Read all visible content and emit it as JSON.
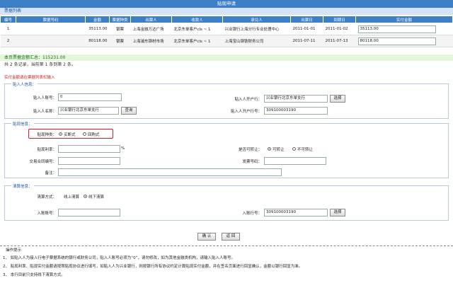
{
  "window": {
    "title": "贴现申请"
  },
  "ticket_list": {
    "section_title": "票据列表",
    "columns": [
      "编号",
      "票据号码",
      "金额",
      "票据种类",
      "出票人",
      "收款人",
      "承兑人",
      "出票日",
      "到期日",
      "实付金额"
    ],
    "rows": [
      {
        "no": "1",
        "amount": "35113.00",
        "kind": "银票",
        "drawer": "上海金融万达广场",
        "payee": "北京东单客户cls ~ 1",
        "acceptor": "兴业银行上海分行专业处理中心",
        "issue_date": "2011-01-01",
        "due_date": "2011-01-02",
        "actual_amount": "35113.00"
      },
      {
        "no": "2",
        "amount": "80118.00",
        "kind": "银票",
        "drawer": "上海浦东钢材市场",
        "payee": "北京东单客户cls ~ 1",
        "acceptor": "上海宝山钢铁财务公司",
        "issue_date": "2011-07-11",
        "due_date": "2011-07-13",
        "actual_amount": "80118.00"
      }
    ],
    "total_text": "本页票据金额汇总：115231.00",
    "pager_text": "共 2 条记录，当前第 1 条到第 2 条。"
  },
  "hint_text": "实付金额请在票据列表栏输入",
  "applicant": {
    "group_title": "贴入人信息：",
    "account_label": "贴入人账号：",
    "account_value": "0",
    "name_label": "贴入人名称：",
    "name_value": "兴业银行北京东单支行",
    "query_button": "查询",
    "bank_label": "贴入人开户行：",
    "bank_value": "兴业银行北京东单支行",
    "select_button": "选择",
    "bank_no_label": "贴入人开户行号：",
    "bank_no_value": "309100003190"
  },
  "discount": {
    "group_title": "贴现信息：",
    "type_label": "贴现种类：",
    "type_options": [
      "买断式",
      "回购式"
    ],
    "type_selected": "买断式",
    "rate_label": "贴现利率：",
    "rate_value": "",
    "rate_unit": "%",
    "transferable_label": "是否可转让：",
    "transferable_options": [
      "可转让",
      "不可转让"
    ],
    "transferable_selected": "可转让",
    "contract_label": "交易合同编号：",
    "contract_value": "",
    "invoice_label": "发票号码：",
    "invoice_value": "",
    "remark_label": "备注：",
    "remark_value": ""
  },
  "settlement": {
    "group_title": "清算信息：",
    "method_label": "清算方式：",
    "method_options": [
      "线上清算",
      "线下清算"
    ],
    "method_selected": "线下清算",
    "account_label": "入账账号：",
    "account_value": "",
    "bank_no_label": "入账行号：",
    "bank_no_value": "309100003190",
    "select_button": "选择"
  },
  "actions": {
    "confirm": "确 认",
    "back": "返 回"
  },
  "tips": {
    "title": "操作提示",
    "items": [
      "1、 如贴入人为接入行电子票据系统的银行或财务公司，贴入人账号必须为“0”，请勿修改，如为其他金融类机构，请输入贴入人账号。",
      "2、 贴现利率、贴现实付金额请按照贴现协议进行填写，如贴入人为兴业银行，则按银行所有协议约定计算贴现实付金额，并在签名页面进行回显确认，金额以银行回显为准。",
      "3、 本行目前只支持线下清算方式。"
    ]
  },
  "colors": {
    "header_blue": "#3d7fc7",
    "section_bg": "#d4e3f5",
    "hint_red": "#d42020",
    "total_green_bg": "#e4f6dc"
  }
}
